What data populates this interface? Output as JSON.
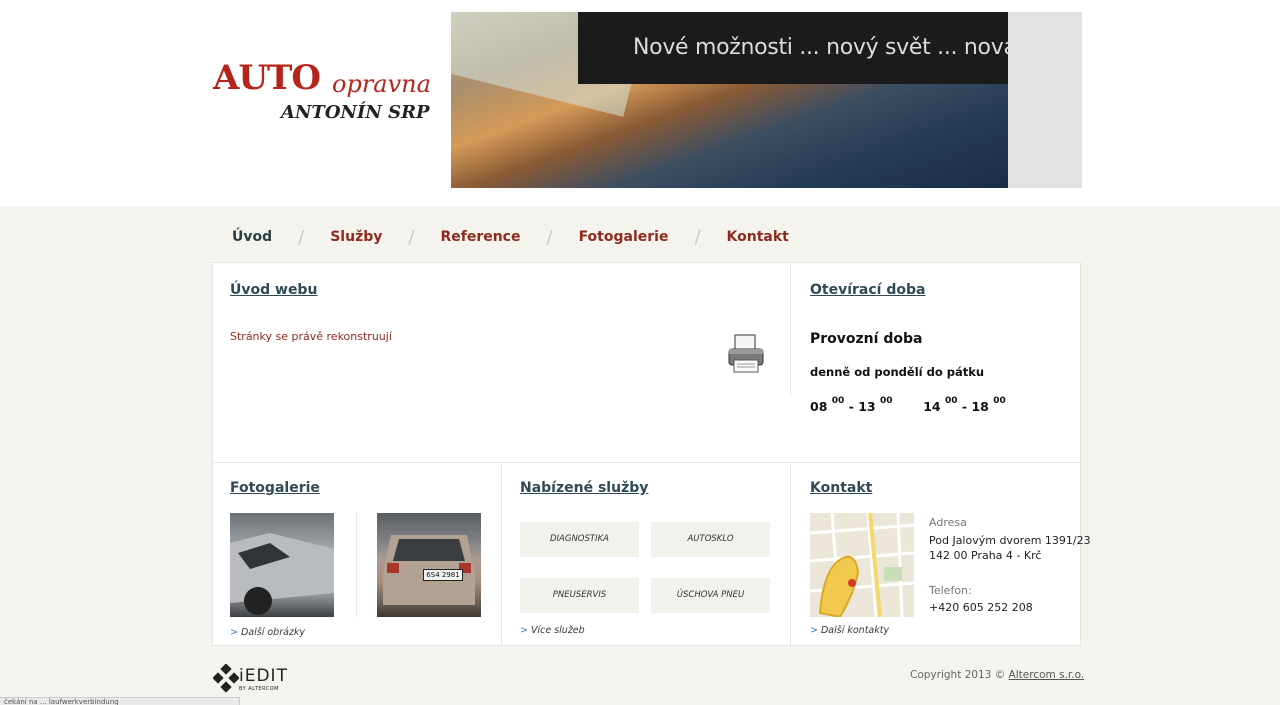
{
  "logo": {
    "auto": "AUTO",
    "opravna": "opravna",
    "owner": "ANTONÍN SRP"
  },
  "banner": {
    "caption": "Nové možnosti ... nový svět ... nová era"
  },
  "nav": {
    "items": [
      "Úvod",
      "Služby",
      "Reference",
      "Fotogalerie",
      "Kontakt"
    ],
    "active": "Úvod",
    "separator": "/"
  },
  "intro": {
    "title": "Úvod webu",
    "text": "Stránky se právě rekonstruují"
  },
  "hours": {
    "title": "Otevírací doba",
    "heading": "Provozní doba",
    "days": "denně od  pondělí do pátku",
    "slot1_start": "08",
    "slot1_end": "13",
    "slot2_start": "14",
    "slot2_end": "18",
    "sup": "00",
    "dash": "-"
  },
  "gallery": {
    "title": "Fotogalerie",
    "more": "Další obrázky",
    "plate": "6S4 2981"
  },
  "services": {
    "title": "Nabízené služby",
    "items": [
      "DIAGNOSTIKA",
      "AUTOSKLO",
      "PNEUSERVIS",
      "ÚSCHOVA PNEU"
    ],
    "more": "Více služeb"
  },
  "contact": {
    "title": "Kontakt",
    "address_label": "Adresa",
    "address_line1": "Pod Jalovým dvorem 1391/23",
    "address_line2": "142 00 Praha 4 - Krč",
    "phone_label": "Telefon:",
    "phone": "+420 605 252 208",
    "more": "Další kontakty"
  },
  "footer": {
    "copyright": "Copyright 2013 ©",
    "company": "Altercom s.r.o.",
    "brand": "iEDIT",
    "brand_sub": "BY ALTERCOM"
  },
  "colors": {
    "accent": "#8f2a1f",
    "heading": "#2f4a55",
    "background": "#f4f3ee"
  },
  "statusbar": {
    "text": "čekání na ... laufwerkverbindung"
  }
}
